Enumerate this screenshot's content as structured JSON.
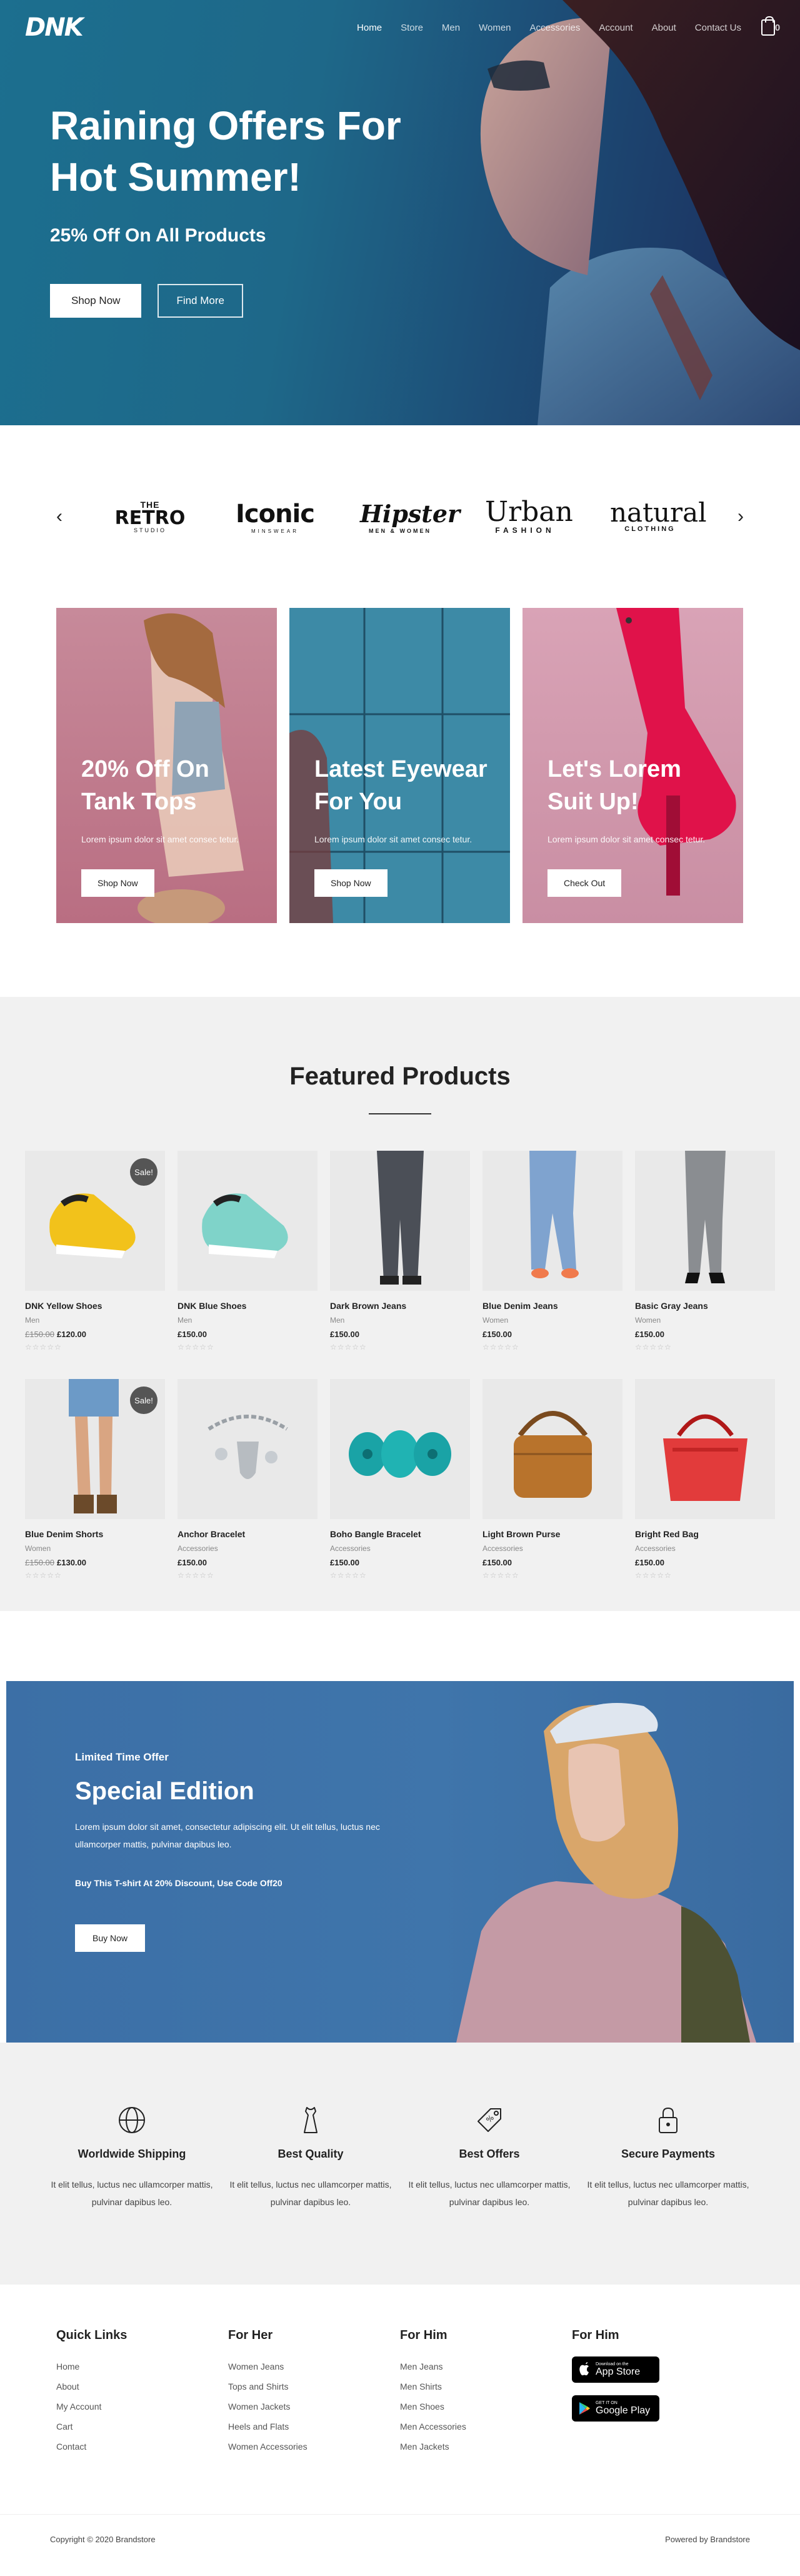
{
  "nav": {
    "logo": "DNK",
    "links": [
      "Home",
      "Store",
      "Men",
      "Women",
      "Accessories",
      "Account",
      "About",
      "Contact Us"
    ],
    "cart_count": "0"
  },
  "hero": {
    "title": "Raining Offers For Hot Summer!",
    "subtitle": "25% Off On All Products",
    "primary_button": "Shop Now",
    "secondary_button": "Find More"
  },
  "brands": {
    "prev_icon": "chevron-left-icon",
    "next_icon": "chevron-right-icon",
    "items": [
      {
        "top": "THE",
        "main": "RETRO",
        "sub": "STUDIO"
      },
      {
        "top": "",
        "main": "Iconic",
        "sub": "MINSWEAR"
      },
      {
        "top": "",
        "main": "Hipster",
        "sub": "MEN & WOMEN"
      },
      {
        "top": "",
        "main": "Urban",
        "sub": "FASHION"
      },
      {
        "top": "",
        "main": "natural",
        "sub": "CLOTHING"
      }
    ]
  },
  "promos": [
    {
      "title": "20% Off On Tank Tops",
      "desc": "Lorem ipsum dolor sit amet consec tetur.",
      "button": "Shop Now"
    },
    {
      "title": "Latest Eyewear For You",
      "desc": "Lorem ipsum dolor sit amet consec tetur.",
      "button": "Shop Now"
    },
    {
      "title": "Let's Lorem Suit Up!",
      "desc": "Lorem ipsum dolor sit amet consec tetur.",
      "button": "Check Out"
    }
  ],
  "featured": {
    "title": "Featured Products",
    "sale_label": "Sale!",
    "rating_stars": "☆☆☆☆☆",
    "products": [
      {
        "name": "DNK Yellow Shoes",
        "category": "Men",
        "old_price": "£150.00",
        "price": "£120.00",
        "sale": true
      },
      {
        "name": "DNK Blue Shoes",
        "category": "Men",
        "old_price": "",
        "price": "£150.00",
        "sale": false
      },
      {
        "name": "Dark Brown Jeans",
        "category": "Men",
        "old_price": "",
        "price": "£150.00",
        "sale": false
      },
      {
        "name": "Blue Denim Jeans",
        "category": "Women",
        "old_price": "",
        "price": "£150.00",
        "sale": false
      },
      {
        "name": "Basic Gray Jeans",
        "category": "Women",
        "old_price": "",
        "price": "£150.00",
        "sale": false
      },
      {
        "name": "Blue Denim Shorts",
        "category": "Women",
        "old_price": "£150.00",
        "price": "£130.00",
        "sale": true
      },
      {
        "name": "Anchor Bracelet",
        "category": "Accessories",
        "old_price": "",
        "price": "£150.00",
        "sale": false
      },
      {
        "name": "Boho Bangle Bracelet",
        "category": "Accessories",
        "old_price": "",
        "price": "£150.00",
        "sale": false
      },
      {
        "name": "Light Brown Purse",
        "category": "Accessories",
        "old_price": "",
        "price": "£150.00",
        "sale": false
      },
      {
        "name": "Bright Red Bag",
        "category": "Accessories",
        "old_price": "",
        "price": "£150.00",
        "sale": false
      }
    ]
  },
  "special": {
    "kicker": "Limited Time Offer",
    "title": "Special Edition",
    "desc": "Lorem ipsum dolor sit amet, consectetur adipiscing elit. Ut elit tellus, luctus nec ullamcorper mattis, pulvinar dapibus leo.",
    "code_text": "Buy This T-shirt At 20% Discount, Use Code Off20",
    "button": "Buy Now"
  },
  "features": [
    {
      "icon": "globe-icon",
      "title": "Worldwide Shipping",
      "text": "It elit tellus, luctus nec ullamcorper mattis, pulvinar dapibus leo."
    },
    {
      "icon": "shirt-icon",
      "title": "Best Quality",
      "text": "It elit tellus, luctus nec ullamcorper mattis, pulvinar dapibus leo."
    },
    {
      "icon": "tag-icon",
      "title": "Best Offers",
      "text": "It elit tellus, luctus nec ullamcorper mattis, pulvinar dapibus leo."
    },
    {
      "icon": "lock-icon",
      "title": "Secure Payments",
      "text": "It elit tellus, luctus nec ullamcorper mattis, pulvinar dapibus leo."
    }
  ],
  "footer": {
    "quick_links": {
      "title": "Quick Links",
      "items": [
        "Home",
        "About",
        "My Account",
        "Cart",
        "Contact"
      ]
    },
    "for_her": {
      "title": "For Her",
      "items": [
        "Women Jeans",
        "Tops and Shirts",
        "Women Jackets",
        "Heels and Flats",
        "Women Accessories"
      ]
    },
    "for_him": {
      "title": "For Him",
      "items": [
        "Men Jeans",
        "Men Shirts",
        "Men Shoes",
        "Men Accessories",
        "Men Jackets"
      ]
    },
    "apps": {
      "title": "For Him",
      "app_store_small": "Download on the",
      "app_store_big": "App Store",
      "google_small": "GET IT ON",
      "google_big": "Google Play"
    },
    "copyright": "Copyright © 2020 Brandstore",
    "powered": "Powered by Brandstore"
  }
}
